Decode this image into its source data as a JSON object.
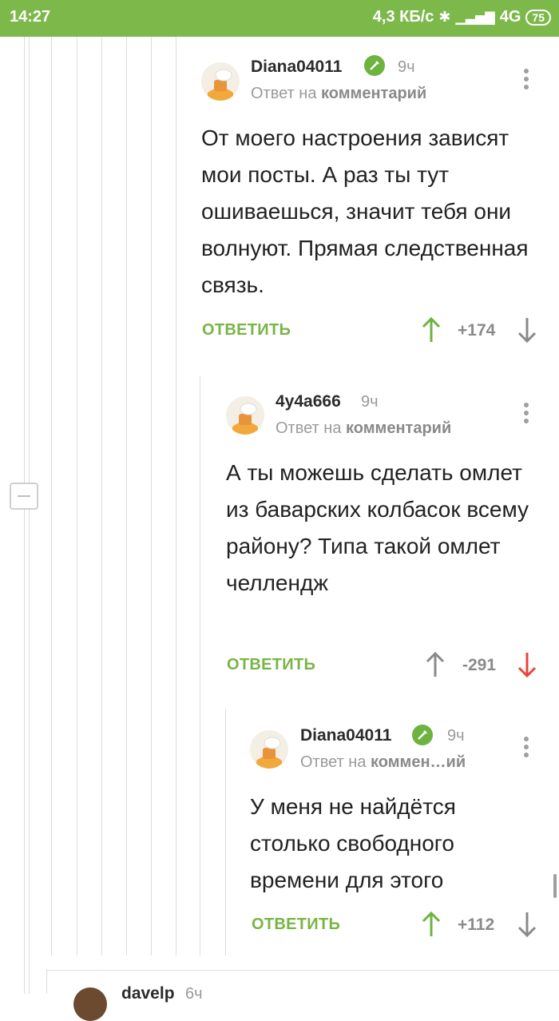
{
  "status_bar": {
    "time": "14:27",
    "speed": "4,3 КБ/с",
    "network": "4G",
    "battery": "75"
  },
  "comments": [
    {
      "username": "Diana04011",
      "time_ago": "9ч",
      "reply_prefix": "Ответ на",
      "reply_target": "комментарий",
      "text": "От моего настроения зависят мои посты. А раз ты тут ошиваешься, значит тебя они волнуют.  Прямая следственная связь.",
      "reply_label": "ОТВЕТИТЬ",
      "rating": "+174",
      "verified": true
    },
    {
      "username": "4y4a666",
      "time_ago": "9ч",
      "reply_prefix": "Ответ на",
      "reply_target": "комментарий",
      "text": "А ты можешь сделать омлет из баварских колбасок всему району? Типа такой омлет челлендж",
      "reply_label": "ОТВЕТИТЬ",
      "rating": "-291",
      "verified": false
    },
    {
      "username": "Diana04011",
      "time_ago": "9ч",
      "reply_prefix": "Ответ на",
      "reply_target": "коммен…ий",
      "text": "У меня не найдётся столько свободного времени для этого",
      "reply_label": "ОТВЕТИТЬ",
      "rating": "+112",
      "verified": true
    }
  ],
  "next_comment": {
    "username": "davelp",
    "time_ago": "6ч"
  },
  "colors": {
    "accent": "#77b544",
    "status_bar": "#7cb94a",
    "downvote_active": "#e8453c"
  }
}
